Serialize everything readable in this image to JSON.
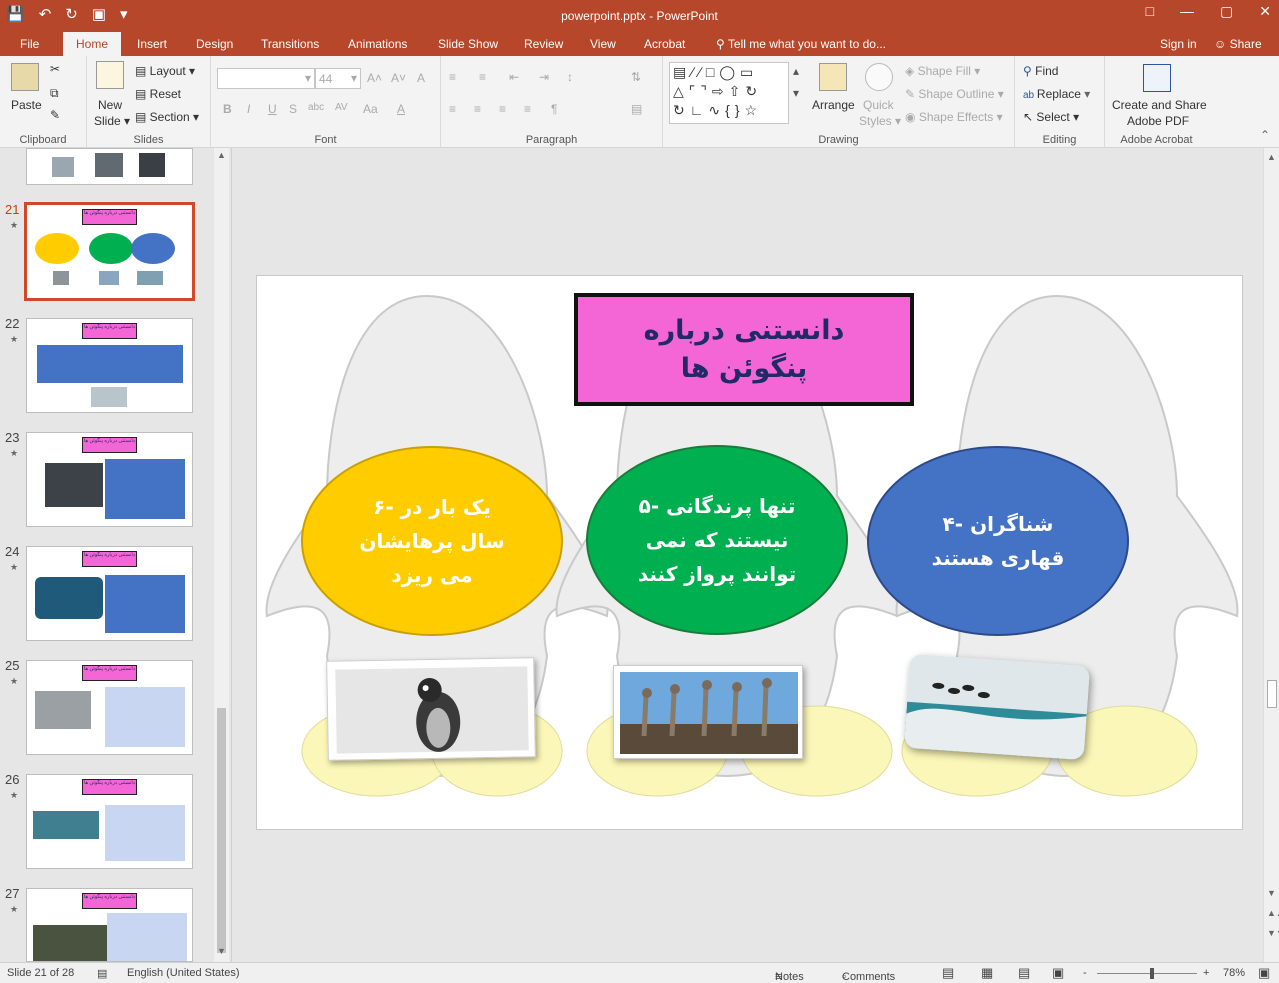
{
  "app": {
    "window_title": "powerpoint.pptx - PowerPoint",
    "qat": {
      "save": "💾",
      "undo": "↶",
      "redo": "↻",
      "present": "▣",
      "more": "▾"
    },
    "window_buttons": {
      "restore": "□",
      "minimize": "—",
      "maximize": "▢",
      "close": "✕"
    }
  },
  "tabs": [
    "File",
    "Home",
    "Insert",
    "Design",
    "Transitions",
    "Animations",
    "Slide Show",
    "Review",
    "View",
    "Acrobat"
  ],
  "active_tab": "Home",
  "tell_me": "Tell me what you want to do...",
  "sign_in": "Sign in",
  "share": "Share",
  "ribbon": {
    "clipboard": {
      "label": "Clipboard",
      "paste": "Paste"
    },
    "slides": {
      "label": "Slides",
      "new_slide": "New",
      "new_slide_2": "Slide ▾",
      "layout": "Layout ▾",
      "reset": "Reset",
      "section": "Section ▾"
    },
    "font": {
      "label": "Font",
      "font_name": "",
      "font_size": "44",
      "bold": "B",
      "italic": "I",
      "underline": "U",
      "strike": "S",
      "shadow": "abc",
      "spacing": "AV",
      "case": "Aa",
      "color": "A",
      "grow": "A˄",
      "shrink": "A˅",
      "clear": "A"
    },
    "paragraph": {
      "label": "Paragraph"
    },
    "drawing": {
      "label": "Drawing",
      "arrange": "Arrange",
      "quick_styles": "Quick",
      "quick_styles_2": "Styles ▾",
      "shape_fill": "Shape Fill ▾",
      "shape_outline": "Shape Outline ▾",
      "shape_effects": "Shape Effects ▾"
    },
    "editing": {
      "label": "Editing",
      "find": "Find",
      "replace": "Replace",
      "select": "Select ▾"
    },
    "acrobat": {
      "label": "Adobe Acrobat",
      "create_share": "Create and Share",
      "create_share_2": "Adobe PDF"
    }
  },
  "thumbnails": [
    {
      "num": "21",
      "star": "★"
    },
    {
      "num": "22",
      "star": "★"
    },
    {
      "num": "23",
      "star": "★"
    },
    {
      "num": "24",
      "star": "★"
    },
    {
      "num": "25",
      "star": "★"
    },
    {
      "num": "26",
      "star": "★"
    },
    {
      "num": "27",
      "star": "★"
    }
  ],
  "thumb_title": "دانستنی درباره پنگوئن ها",
  "slide": {
    "title_line1": "دانستنی درباره",
    "title_line2": "پنگوئن ها",
    "ellipses": [
      {
        "lines": [
          "۶- یک بار در",
          "سال پرهایشان",
          "می ریزد"
        ],
        "color": "#ffcc00"
      },
      {
        "lines": [
          "۵- تنها پرندگانی",
          "نیستند که نمی",
          "توانند پرواز کنند"
        ],
        "color": "#00b050"
      },
      {
        "lines": [
          "۴- شناگران",
          "قهاری هستند"
        ],
        "color": "#4472c4"
      }
    ]
  },
  "status": {
    "slide_of": "Slide 21 of 28",
    "language": "English (United States)",
    "notes": "Notes",
    "comments": "Comments",
    "zoom": "78%",
    "minus": "-",
    "plus": "+"
  }
}
